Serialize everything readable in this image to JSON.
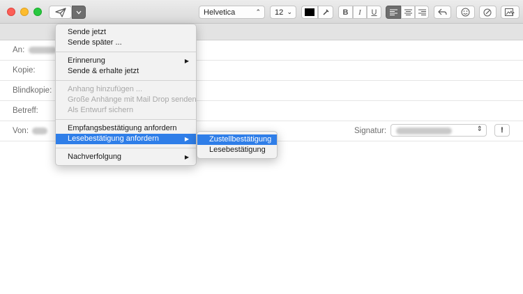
{
  "toolbar": {
    "send_icon": "paper-plane-icon",
    "send_menu_chevron": "⌄",
    "font_family": "Helvetica",
    "font_size": "12",
    "text_color": "#000000",
    "bold": "B",
    "italic": "I",
    "underline": "U",
    "active_alignment": "left"
  },
  "fields": {
    "to_label": "An:",
    "cc_label": "Kopie:",
    "bcc_label": "Blindkopie:",
    "subject_label": "Betreff:",
    "from_label": "Von:",
    "signature_label": "Signatur:",
    "priority_label": "!"
  },
  "send_menu": {
    "items": [
      {
        "label": "Sende jetzt",
        "enabled": true
      },
      {
        "label": "Sende später ...",
        "enabled": true
      },
      {
        "label": "Erinnerung",
        "enabled": true,
        "submenu": true
      },
      {
        "label": "Sende & erhalte jetzt",
        "enabled": true
      },
      {
        "label": "Anhang hinzufügen ...",
        "enabled": false
      },
      {
        "label": "Große Anhänge mit Mail Drop senden",
        "enabled": false
      },
      {
        "label": "Als Entwurf sichern",
        "enabled": false
      },
      {
        "label": "Empfangsbestätigung anfordern",
        "enabled": true
      },
      {
        "label": "Lesebestätigung anfordern",
        "enabled": true,
        "submenu": true,
        "highlighted": true
      },
      {
        "label": "Nachverfolgung",
        "enabled": true,
        "submenu": true
      }
    ]
  },
  "receipt_submenu": {
    "items": [
      {
        "label": "Zustellbestätigung",
        "highlighted": true
      },
      {
        "label": "Lesebestätigung",
        "highlighted": false
      }
    ]
  },
  "colors": {
    "highlight": "#2f7ee8"
  }
}
